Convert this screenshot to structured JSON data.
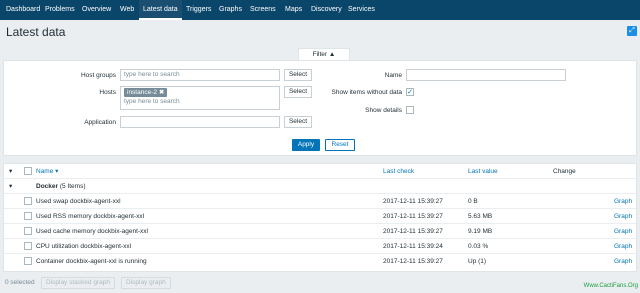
{
  "nav": {
    "items": [
      {
        "label": "Dashboard"
      },
      {
        "label": "Problems"
      },
      {
        "label": "Overview"
      },
      {
        "label": "Web"
      },
      {
        "label": "Latest data",
        "active": true
      },
      {
        "label": "Triggers"
      },
      {
        "label": "Graphs"
      },
      {
        "label": "Screens"
      },
      {
        "label": "Maps"
      },
      {
        "label": "Discovery"
      },
      {
        "label": "Services"
      }
    ]
  },
  "page": {
    "title": "Latest data",
    "expand_icon": "fullscreen-icon"
  },
  "filter": {
    "tab_label": "Filter",
    "host_groups_label": "Host groups",
    "host_groups_placeholder": "type here to search",
    "hosts_label": "Hosts",
    "hosts_tag": "instance-2",
    "hosts_placeholder": "type here to search",
    "application_label": "Application",
    "application_value": "",
    "select_label": "Select",
    "name_label": "Name",
    "name_value": "",
    "show_without_data_label": "Show items without data",
    "show_without_data_checked": true,
    "show_details_label": "Show details",
    "show_details_checked": false,
    "apply_label": "Apply",
    "reset_label": "Reset"
  },
  "table": {
    "headers": {
      "name": "Name",
      "last_check": "Last check",
      "last_value": "Last value",
      "change": "Change"
    },
    "group": {
      "name": "Docker",
      "count": "(5 Items)"
    },
    "rows": [
      {
        "name": "Used swap dockbix-agent-xxl",
        "last_check": "2017-12-11 15:39:27",
        "last_value": "0 B",
        "change": "",
        "link": "Graph"
      },
      {
        "name": "Used RSS memory dockbix-agent-xxl",
        "last_check": "2017-12-11 15:39:27",
        "last_value": "5.63 MB",
        "change": "",
        "link": "Graph"
      },
      {
        "name": "Used cache memory dockbix-agent-xxl",
        "last_check": "2017-12-11 15:39:27",
        "last_value": "9.19 MB",
        "change": "",
        "link": "Graph"
      },
      {
        "name": "CPU utilization dockbix-agent-xxl",
        "last_check": "2017-12-11 15:39:24",
        "last_value": "0.03 %",
        "change": "",
        "link": "Graph"
      },
      {
        "name": "Container dockbix-agent-xxl is running",
        "last_check": "2017-12-11 15:39:27",
        "last_value": "Up (1)",
        "change": "",
        "link": "Graph"
      }
    ]
  },
  "footer": {
    "selected": "0 selected",
    "stacked_graph": "Display stacked graph",
    "graph": "Display graph"
  },
  "watermark": "Www.CactiFans.Org"
}
